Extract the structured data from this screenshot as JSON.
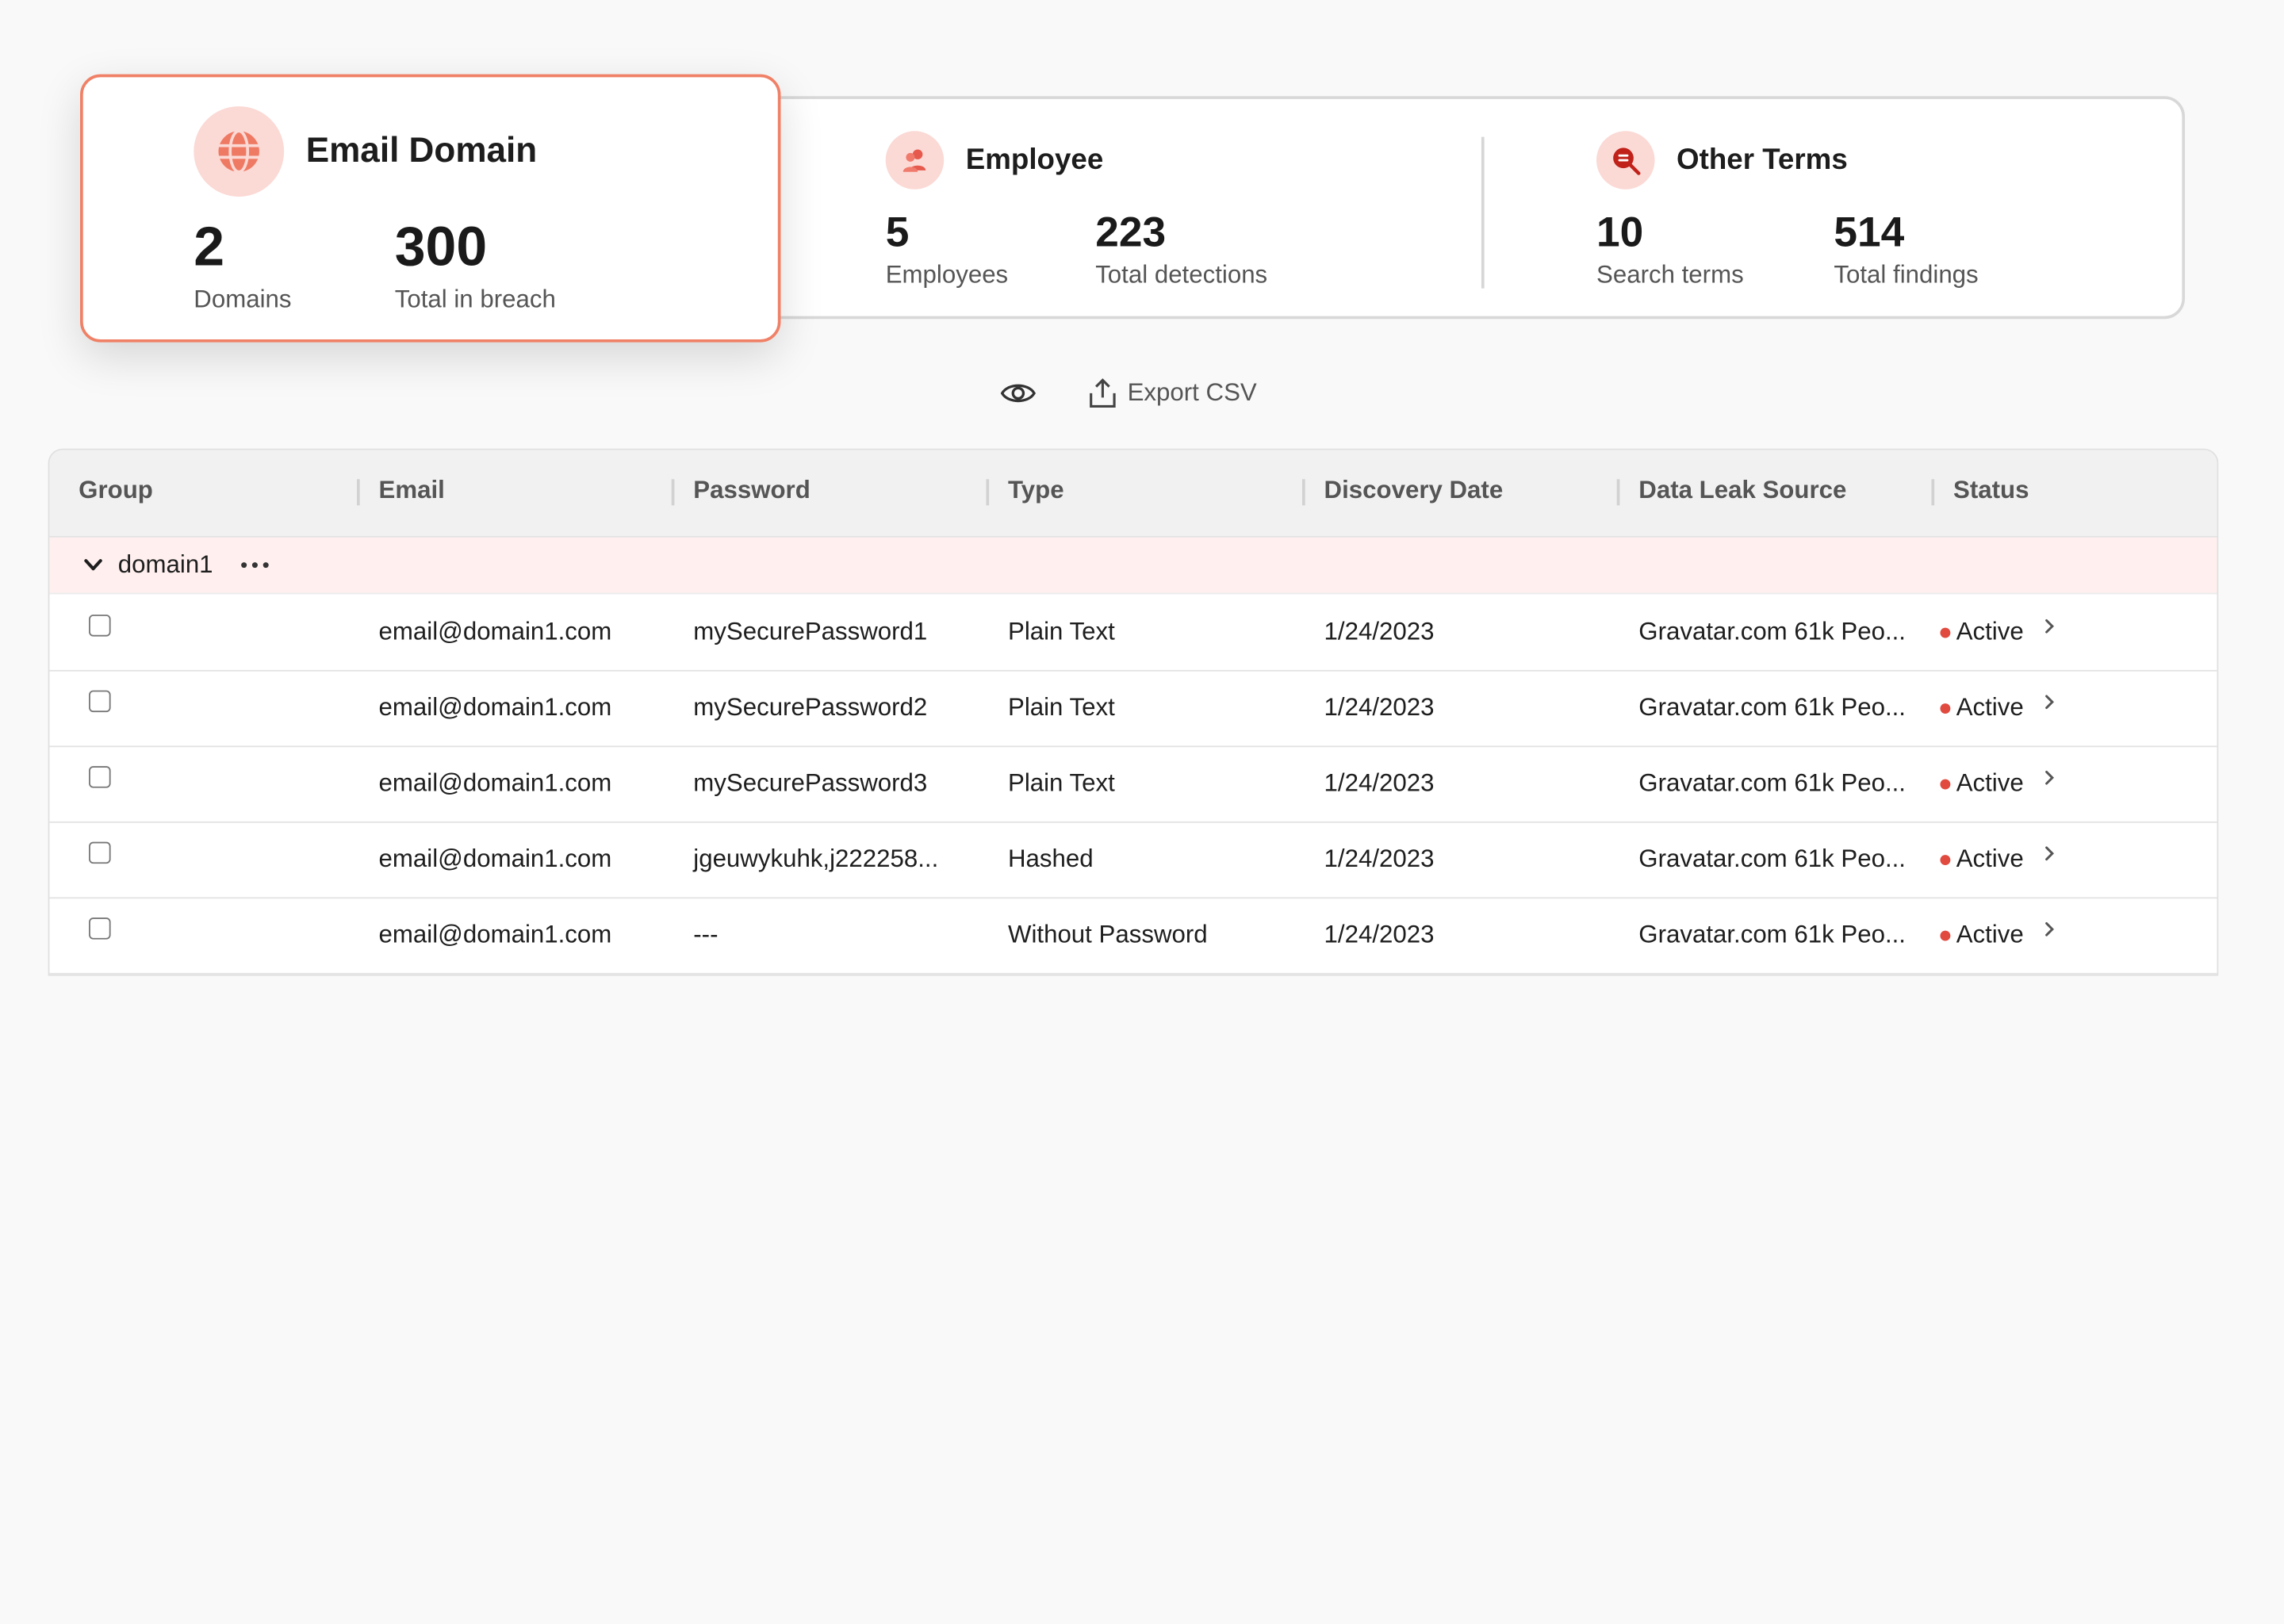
{
  "cards": {
    "email_domain": {
      "title": "Email Domain",
      "stat1_value": "2",
      "stat1_label": "Domains",
      "stat2_value": "300",
      "stat2_label": "Total in breach"
    },
    "employee": {
      "title": "Employee",
      "stat1_value": "5",
      "stat1_label": "Employees",
      "stat2_value": "223",
      "stat2_label": "Total detections"
    },
    "other_terms": {
      "title": "Other Terms",
      "stat1_value": "10",
      "stat1_label": "Search terms",
      "stat2_value": "514",
      "stat2_label": "Total findings"
    }
  },
  "toolbar": {
    "export_label": "Export CSV"
  },
  "table": {
    "headers": [
      "Group",
      "Email",
      "Password",
      "Type",
      "Discovery Date",
      "Data Leak Source",
      "Status"
    ],
    "group": {
      "name": "domain1"
    },
    "rows": [
      {
        "email": "email@domain1.com",
        "password": "mySecurePassword1",
        "type": "Plain Text",
        "date": "1/24/2023",
        "source": "Gravatar.com 61k Peo...",
        "status": "Active"
      },
      {
        "email": "email@domain1.com",
        "password": "mySecurePassword2",
        "type": "Plain Text",
        "date": "1/24/2023",
        "source": "Gravatar.com 61k Peo...",
        "status": "Active"
      },
      {
        "email": "email@domain1.com",
        "password": "mySecurePassword3",
        "type": "Plain Text",
        "date": "1/24/2023",
        "source": "Gravatar.com 61k Peo...",
        "status": "Active"
      },
      {
        "email": "email@domain1.com",
        "password": "jgeuwykuhk,j222258...",
        "type": "Hashed",
        "date": "1/24/2023",
        "source": "Gravatar.com 61k Peo...",
        "status": "Active"
      },
      {
        "email": "email@domain1.com",
        "password": "---",
        "type": "Without Password",
        "date": "1/24/2023",
        "source": "Gravatar.com 61k Peo...",
        "status": "Active"
      }
    ]
  },
  "colors": {
    "accent": "#f08066",
    "status_active": "#e04a3f",
    "group_row_bg": "#fff0ef"
  }
}
